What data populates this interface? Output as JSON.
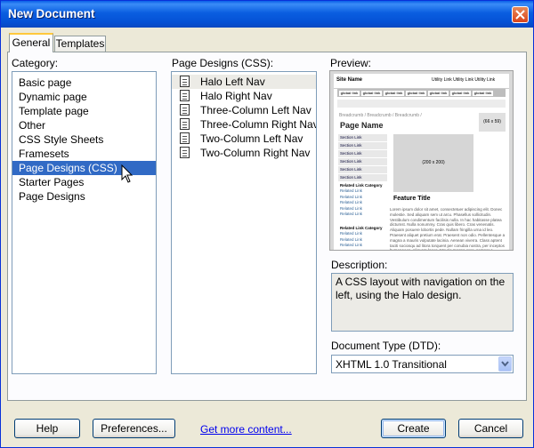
{
  "window": {
    "title": "New Document"
  },
  "tabs": [
    {
      "label": "General",
      "active": true
    },
    {
      "label": "Templates",
      "active": false
    }
  ],
  "category": {
    "label": "Category:",
    "items": [
      "Basic page",
      "Dynamic page",
      "Template page",
      "Other",
      "CSS Style Sheets",
      "Framesets",
      "Page Designs (CSS)",
      "Starter Pages",
      "Page Designs"
    ],
    "selected": "Page Designs (CSS)"
  },
  "page_designs": {
    "label": "Page Designs (CSS):",
    "items": [
      "Halo Left Nav",
      "Halo Right Nav",
      "Three-Column Left Nav",
      "Three-Column Right Nav",
      "Two-Column Left Nav",
      "Two-Column Right Nav"
    ],
    "selected": "Halo Left Nav"
  },
  "preview": {
    "label": "Preview:",
    "site_name": "Site Name",
    "utility_links": "Utility Link   Utility Link   Utility Link",
    "global_link": "global link",
    "breadcrumb": "Breadcrumb / Breadcrumb / Breadcrumb /",
    "page_name": "Page Name",
    "ad": "(66 x 59)",
    "section_link": "Section Link",
    "related_category": "Related Link Category",
    "related_link": "Related Link",
    "image": "(200 x 200)",
    "feature_title": "Feature Title",
    "lorem": "Lorem ipsum dolor sit amet, consectetuer adipiscing elit. Donec molestie. Sed aliquam sem ut arcu. Phasellus sollicitudin. Vestibulum condimentum facilisis nulla. In hac habitasse platea dictumst. Nulla nonummy. Cras quis libero. Cras venenatis. Aliquam posuere lobortis pede. Nullam fringilla urna id leo. Praesent aliquet pretium erat. Praesent non odio. Pellentesque a magna a mauris vulputate lacinia. Aenean viverra. Class aptent taciti sociosqu ad litora torquent per conubia nostra, per inceptos hymenaeos. Aliquam lacus. Mauris magna eros, semper a, tempor et."
  },
  "description": {
    "label": "Description:",
    "text": "A CSS layout with navigation on the left, using the Halo design."
  },
  "doctype": {
    "label": "Document Type (DTD):",
    "value": "XHTML 1.0 Transitional"
  },
  "buttons": {
    "help": "Help",
    "preferences": "Preferences...",
    "get_more": "Get more content...",
    "create": "Create",
    "cancel": "Cancel"
  },
  "colors": {
    "titlebar": "#0a5fe8",
    "selection": "#316ac5",
    "face": "#ece9d8"
  }
}
